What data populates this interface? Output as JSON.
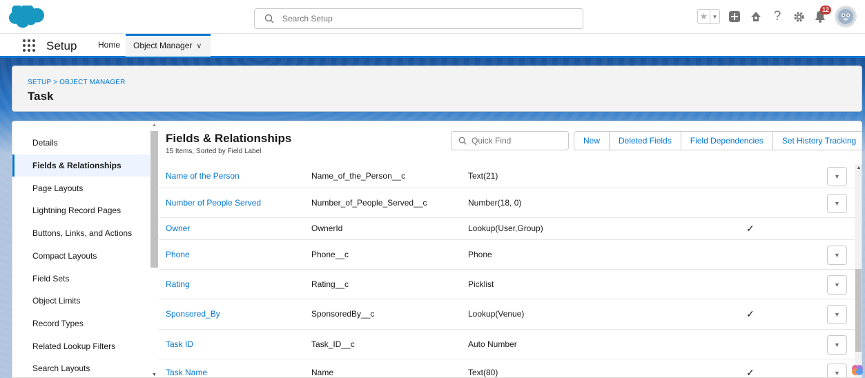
{
  "header": {
    "search_placeholder": "Search Setup",
    "notification_count": "12",
    "icons": [
      "favorites-star-icon",
      "favorites-dropdown-icon",
      "global-actions-add-icon",
      "trailhead-icon",
      "help-icon",
      "setup-gear-icon",
      "notifications-bell-icon",
      "user-avatar"
    ]
  },
  "context_bar": {
    "app_name": "Setup",
    "nav_home": "Home",
    "nav_object_manager": "Object Manager",
    "chevron": "∨"
  },
  "page_header": {
    "breadcrumb": "SETUP > OBJECT MANAGER",
    "title": "Task"
  },
  "sidebar": {
    "items": [
      {
        "label": "Details"
      },
      {
        "label": "Fields & Relationships"
      },
      {
        "label": "Page Layouts"
      },
      {
        "label": "Lightning Record Pages"
      },
      {
        "label": "Buttons, Links, and Actions"
      },
      {
        "label": "Compact Layouts"
      },
      {
        "label": "Field Sets"
      },
      {
        "label": "Object Limits"
      },
      {
        "label": "Record Types"
      },
      {
        "label": "Related Lookup Filters"
      },
      {
        "label": "Search Layouts"
      }
    ],
    "active": "Fields & Relationships"
  },
  "content": {
    "title": "Fields & Relationships",
    "subtitle": "15 Items, Sorted by Field Label",
    "quick_find_placeholder": "Quick Find",
    "buttons": {
      "new": "New",
      "deleted_fields": "Deleted Fields",
      "field_dependencies": "Field Dependencies",
      "set_history_tracking": "Set History Tracking"
    },
    "rows": [
      {
        "label": "Name of the Person",
        "api_name": "Name_of_the_Person__c",
        "type": "Text(21)",
        "indexed": "",
        "menu": true
      },
      {
        "label": "Number of People Served",
        "api_name": "Number_of_People_Served__c",
        "type": "Number(18, 0)",
        "indexed": "",
        "menu": true
      },
      {
        "label": "Owner",
        "api_name": "OwnerId",
        "type": "Lookup(User,Group)",
        "indexed": "✓",
        "menu": false
      },
      {
        "label": "Phone",
        "api_name": "Phone__c",
        "type": "Phone",
        "indexed": "",
        "menu": true
      },
      {
        "label": "Rating",
        "api_name": "Rating__c",
        "type": "Picklist",
        "indexed": "",
        "menu": true
      },
      {
        "label": "Sponsored_By",
        "api_name": "SponsoredBy__c",
        "type": "Lookup(Venue)",
        "indexed": "✓",
        "menu": true
      },
      {
        "label": "Task ID",
        "api_name": "Task_ID__c",
        "type": "Auto Number",
        "indexed": "",
        "menu": true
      },
      {
        "label": "Task Name",
        "api_name": "Name",
        "type": "Text(80)",
        "indexed": "✓",
        "menu": true
      }
    ]
  },
  "colors": {
    "brand": "#0176d3",
    "link": "#0176d3",
    "badge": "#c23934"
  }
}
